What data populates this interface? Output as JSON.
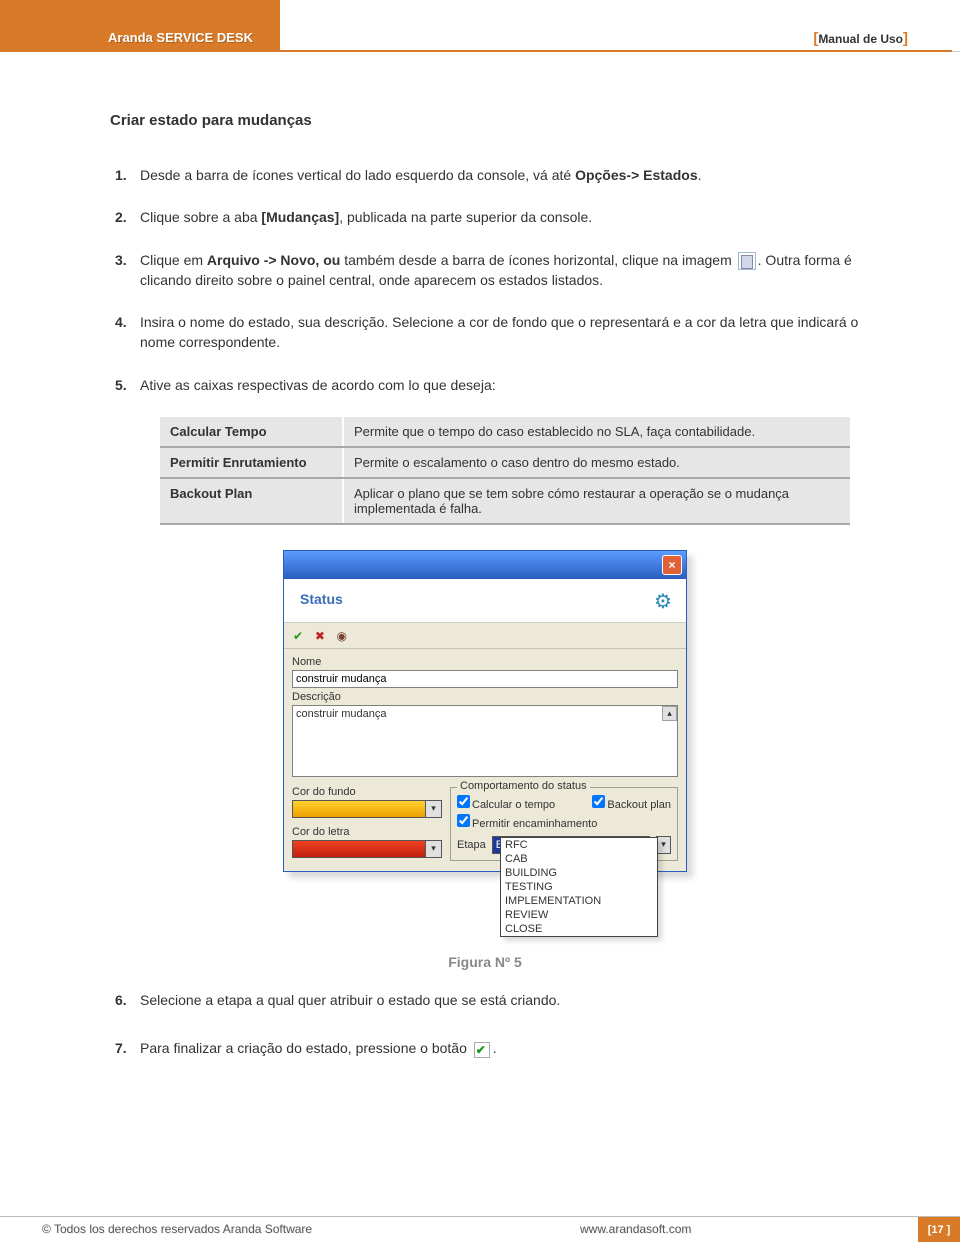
{
  "header": {
    "product": "Aranda SERVICE DESK",
    "manual": "Manual de Uso"
  },
  "heading": "Criar estado para mudanças",
  "steps": {
    "s1_pre": "Desde a barra de ícones vertical do lado esquerdo da console, vá até ",
    "s1_bold": "Opções-> Estados",
    "s1_post": ".",
    "s2_pre": "Clique sobre a aba ",
    "s2_bold": "[Mudanças]",
    "s2_post": ", publicada na parte superior da console.",
    "s3_pre": "Clique em ",
    "s3_bold": "Arquivo -> Novo, ou",
    "s3_mid": " também desde a barra de ícones horizontal, clique na imagem ",
    "s3_post": ". Outra forma é clicando direito sobre o painel central, onde aparecem os estados listados.",
    "s4": "Insira o nome do estado, sua descrição. Selecione a cor de fondo que o representará e a cor da letra que indicará o nome correspondente.",
    "s5": "Ative as caixas respectivas de acordo com lo que deseja:",
    "s6": "Selecione a etapa a qual quer atribuir o estado que se está criando.",
    "s7_pre": "Para finalizar a criação do estado, pressione o botão ",
    "s7_post": "."
  },
  "table": {
    "rows": [
      {
        "k": "Calcular Tempo",
        "v": "Permite que o tempo do caso establecido no SLA, faça contabilidade."
      },
      {
        "k": "Permitir Enrutamiento",
        "v": "Permite o escalamento o caso dentro do mesmo estado."
      },
      {
        "k": "Backout Plan",
        "v": "Aplicar o plano que se tem sobre cómo restaurar a operação se o mudança implementada é falha."
      }
    ]
  },
  "dialog": {
    "status": "Status",
    "nome_label": "Nome",
    "nome_value": "construir mudança",
    "desc_label": "Descrição",
    "desc_value": "construir mudança",
    "cor_fundo": "Cor do fundo",
    "cor_letra": "Cor do letra",
    "fieldset": "Comportamento do status",
    "cb_calc": "Calcular o tempo",
    "cb_backout": "Backout plan",
    "cb_perm": "Permitir encaminhamento",
    "etapa_label": "Etapa",
    "etapa_sel": "BUILDING",
    "options": [
      "RFC",
      "CAB",
      "BUILDING",
      "TESTING",
      "IMPLEMENTATION",
      "REVIEW",
      "CLOSE"
    ]
  },
  "figure_caption": "Figura Nº 5",
  "footer": {
    "copyright": "© Todos los derechos reservados Aranda Software",
    "url": "www.arandasoft.com",
    "page": "[17 ]"
  }
}
